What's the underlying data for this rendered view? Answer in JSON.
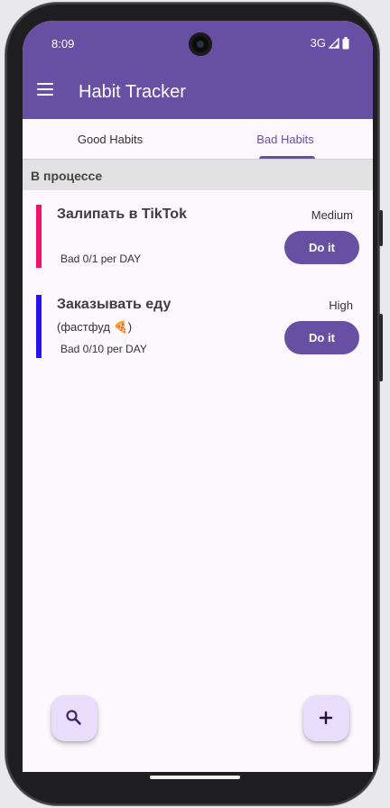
{
  "status_bar": {
    "time": "8:09",
    "network": "3G"
  },
  "app_bar": {
    "title": "Habit Tracker",
    "menu_icon": "menu-icon"
  },
  "tabs": [
    {
      "label": "Good Habits",
      "active": false
    },
    {
      "label": "Bad Habits",
      "active": true
    }
  ],
  "section": {
    "title": "В процессе"
  },
  "habits": [
    {
      "name": "Залипать в TikTok",
      "description": "",
      "count": "Bad 0/1 per DAY",
      "priority": "Medium",
      "action_label": "Do it",
      "color": "#f3116c"
    },
    {
      "name": "Заказывать еду",
      "description": "(фастфуд 🍕)",
      "count": "Bad 0/10 per DAY",
      "priority": "High",
      "action_label": "Do it",
      "color": "#2a0ff0"
    }
  ],
  "fabs": {
    "search_icon": "search-icon",
    "add_icon": "plus-icon"
  },
  "colors": {
    "primary": "#6750a4",
    "background": "#fdf7fe",
    "section_header": "#e2e2e2",
    "fab": "#e9ddfb"
  }
}
